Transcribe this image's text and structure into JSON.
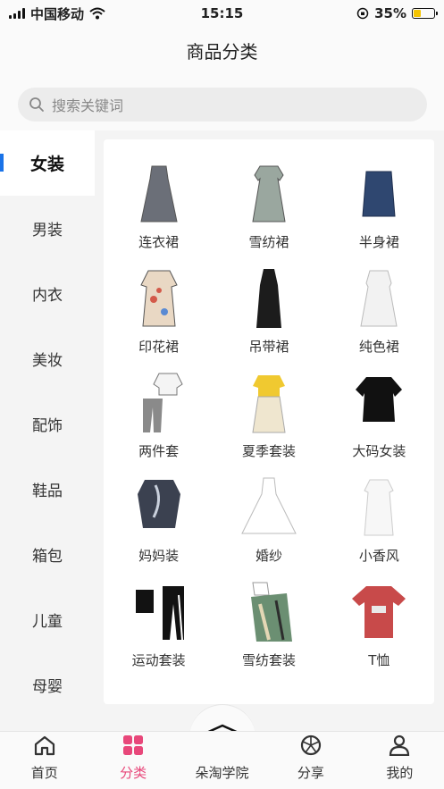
{
  "status": {
    "carrier": "中国移动",
    "time": "15:15",
    "battery": "35%",
    "battery_level": 0.35
  },
  "header": {
    "title": "商品分类"
  },
  "search": {
    "placeholder": "搜索关键词"
  },
  "sidebar": {
    "items": [
      {
        "label": "女装",
        "active": true
      },
      {
        "label": "男装"
      },
      {
        "label": "内衣"
      },
      {
        "label": "美妆"
      },
      {
        "label": "配饰"
      },
      {
        "label": "鞋品"
      },
      {
        "label": "箱包"
      },
      {
        "label": "儿童"
      },
      {
        "label": "母婴"
      }
    ]
  },
  "products": [
    {
      "label": "连衣裙",
      "icon": "dress-icon",
      "color": "#6b6f78"
    },
    {
      "label": "雪纺裙",
      "icon": "chiffon-dress-icon",
      "color": "#9aa79f"
    },
    {
      "label": "半身裙",
      "icon": "skirt-icon",
      "color": "#2f4770"
    },
    {
      "label": "印花裙",
      "icon": "print-dress-icon",
      "color": "#e9d8c4"
    },
    {
      "label": "吊带裙",
      "icon": "slip-dress-icon",
      "color": "#1c1c1c"
    },
    {
      "label": "纯色裙",
      "icon": "solid-dress-icon",
      "color": "#f2f2f2"
    },
    {
      "label": "两件套",
      "icon": "two-piece-icon",
      "color": "#8a8a8a"
    },
    {
      "label": "夏季套装",
      "icon": "summer-set-icon",
      "color": "#f0c930"
    },
    {
      "label": "大码女装",
      "icon": "plus-size-icon",
      "color": "#111111"
    },
    {
      "label": "妈妈装",
      "icon": "mom-wear-icon",
      "color": "#3b4150"
    },
    {
      "label": "婚纱",
      "icon": "wedding-dress-icon",
      "color": "#ffffff"
    },
    {
      "label": "小香风",
      "icon": "tweed-dress-icon",
      "color": "#f7f7f7"
    },
    {
      "label": "运动套装",
      "icon": "sportswear-icon",
      "color": "#121212"
    },
    {
      "label": "雪纺套装",
      "icon": "chiffon-set-icon",
      "color": "#6b8f72"
    },
    {
      "label": "T恤",
      "icon": "tshirt-icon",
      "color": "#c84a4a"
    }
  ],
  "tabbar": {
    "items": [
      {
        "label": "首页",
        "icon": "home-icon"
      },
      {
        "label": "分类",
        "icon": "category-icon",
        "active": true
      },
      {
        "label": "朵淘学院",
        "icon": "graduation-cap-icon"
      },
      {
        "label": "分享",
        "icon": "share-icon"
      },
      {
        "label": "我的",
        "icon": "profile-icon"
      }
    ]
  },
  "colors": {
    "accent": "#e8477a",
    "sidebar_indicator": "#1a73e8",
    "battery": "#f5c400"
  }
}
